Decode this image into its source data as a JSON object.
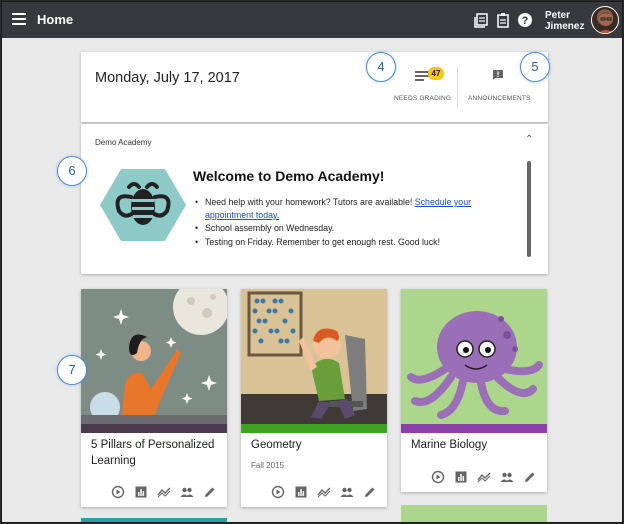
{
  "topbar": {
    "title": "Home",
    "user_first": "Peter",
    "user_last": "Jimenez",
    "icons": [
      "menu-icon",
      "notes-icon",
      "clipboard-icon",
      "help-icon"
    ]
  },
  "header": {
    "date": "Monday, July 17, 2017",
    "needs_grading_label": "NEEDS GRADING",
    "needs_grading_count": "47",
    "announcements_label": "ANNOUNCEMENTS"
  },
  "callouts": {
    "c4": "4",
    "c5": "5",
    "c6": "6",
    "c7": "7"
  },
  "academy": {
    "name": "Demo Academy",
    "welcome": "Welcome to Demo Academy!",
    "bullet1_text": "Need help with your homework? Tutors are available! ",
    "bullet1_link": "Schedule your appointment today.",
    "bullet2": "School assembly on Wednesday.",
    "bullet3": "Testing on Friday. Remember to get enough rest. Good luck!"
  },
  "courses": [
    {
      "name": "5 Pillars of Personalized Learning",
      "term": "",
      "stripe": "#4b3a4d"
    },
    {
      "name": "Geometry",
      "term": "Fall 2015",
      "stripe": "#3da321"
    },
    {
      "name": "Marine Biology",
      "term": "",
      "stripe": "#8b3fa8"
    }
  ],
  "colors": {
    "accent": "#4a8ad6",
    "topbar": "#37393c",
    "badge": "#f5c518",
    "link": "#1a4fd1"
  }
}
